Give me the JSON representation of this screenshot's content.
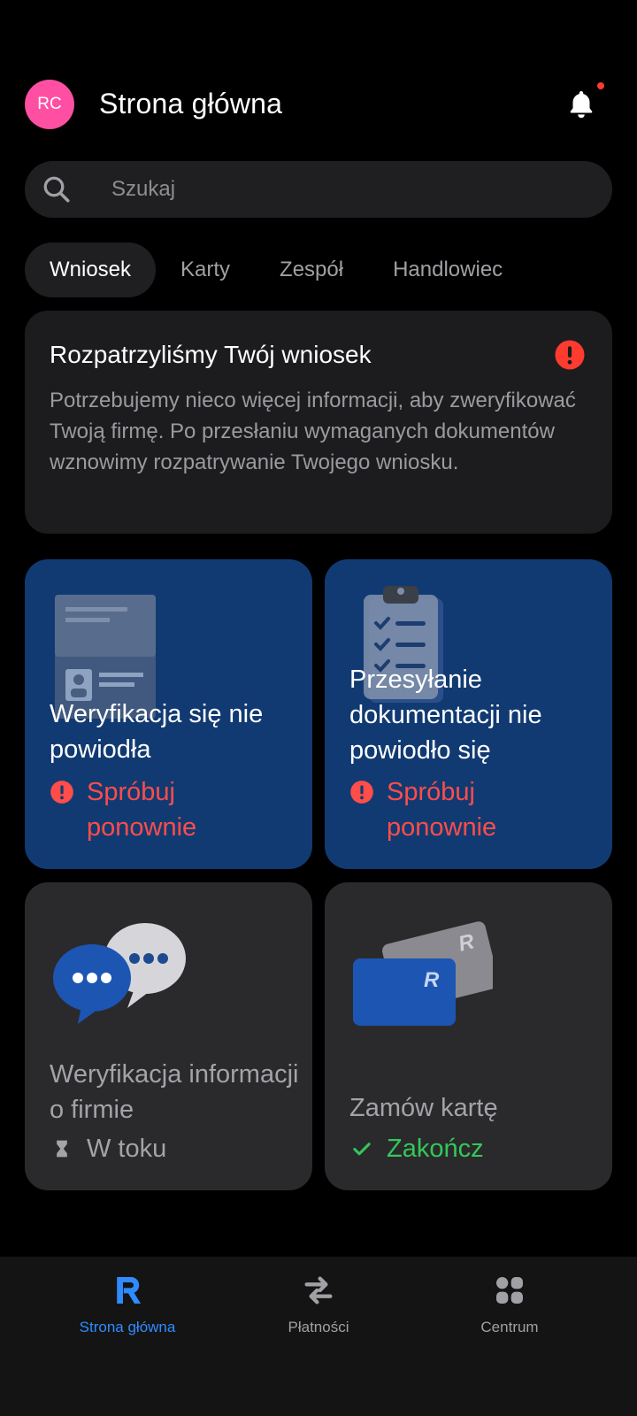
{
  "header": {
    "avatar_initials": "RC",
    "avatar_color": "#ff4fa3",
    "title": "Strona główna",
    "notification_icon": "bell-icon",
    "has_unread": true
  },
  "search": {
    "placeholder": "Szukaj",
    "value": ""
  },
  "tabs": [
    {
      "label": "Wniosek",
      "active": true
    },
    {
      "label": "Karty",
      "active": false
    },
    {
      "label": "Zespół",
      "active": false
    },
    {
      "label": "Handlowiec",
      "active": false
    }
  ],
  "alert": {
    "title": "Rozpatrzyliśmy Twój wniosek",
    "body": "Potrzebujemy nieco więcej informacji, aby zweryfikować Twoją firmę. Po przesłaniu wymaganych dokumentów wznowimy rozpatrywanie Twojego wniosku.",
    "icon": "error-icon",
    "color": "#ff3b30"
  },
  "tiles": [
    {
      "title": "Weryfikacja się nie powiodła",
      "status": "Spróbuj ponownie",
      "status_icon": "error-icon",
      "status_color": "#ff4d4a",
      "illustration": "id-document-icon"
    },
    {
      "title": "Przesyłanie dokumentacji nie powiodło się",
      "status": "Spróbuj ponownie",
      "status_icon": "error-icon",
      "status_color": "#ff4d4a",
      "illustration": "clipboard-checklist-icon"
    },
    {
      "title": "Weryfikacja informacji o firmie",
      "status": "W toku",
      "status_icon": "hourglass-icon",
      "status_color": "#a3a3a8",
      "illustration": "chat-bubbles-icon"
    },
    {
      "title": "Zamów kartę",
      "status": "Zakończ",
      "status_icon": "checkmark-icon",
      "status_color": "#34c759",
      "illustration": "cards-icon"
    }
  ],
  "bottom_nav": [
    {
      "label": "Strona główna",
      "icon": "revolut-logo-icon",
      "active": true
    },
    {
      "label": "Płatności",
      "icon": "transfer-arrows-icon",
      "active": false
    },
    {
      "label": "Centrum",
      "icon": "grid-apps-icon",
      "active": false
    }
  ],
  "colors": {
    "background": "#000000",
    "card": "#1c1c1e",
    "tile_blue": "#113a72",
    "tile_grey": "#2a2a2c",
    "accent": "#2f8cff"
  }
}
